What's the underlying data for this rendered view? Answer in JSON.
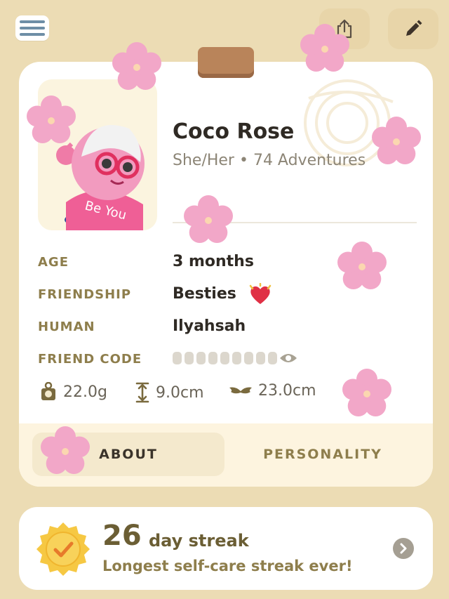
{
  "profile": {
    "name": "Coco Rose",
    "subtitle": "She/Her • 74 Adventures",
    "shirt_text": "Be You"
  },
  "details": {
    "age_label": "AGE",
    "age_value": "3 months",
    "friendship_label": "FRIENDSHIP",
    "friendship_value": "Besties",
    "human_label": "HUMAN",
    "human_value": "Ilyahsah",
    "friend_code_label": "FRIEND CODE"
  },
  "stats": {
    "weight": "22.0g",
    "height": "9.0cm",
    "wingspan": "23.0cm"
  },
  "tabs": {
    "about": "ABOUT",
    "personality": "PERSONALITY"
  },
  "streak": {
    "count": "26",
    "unit": "day streak",
    "message": "Longest self-care streak ever!"
  },
  "icons": {
    "menu": "hamburger-menu-icon",
    "share": "share-icon",
    "edit": "pencil-icon",
    "heart": "heart-icon",
    "eye": "eye-icon",
    "weight": "weight-icon",
    "height": "height-icon",
    "wings": "wings-icon",
    "streak_badge": "check-badge-icon",
    "chevron": "chevron-right-icon"
  },
  "colors": {
    "background": "#ecdcb4",
    "accent_label": "#8e7e4c",
    "flower": "#f2a7c8"
  }
}
